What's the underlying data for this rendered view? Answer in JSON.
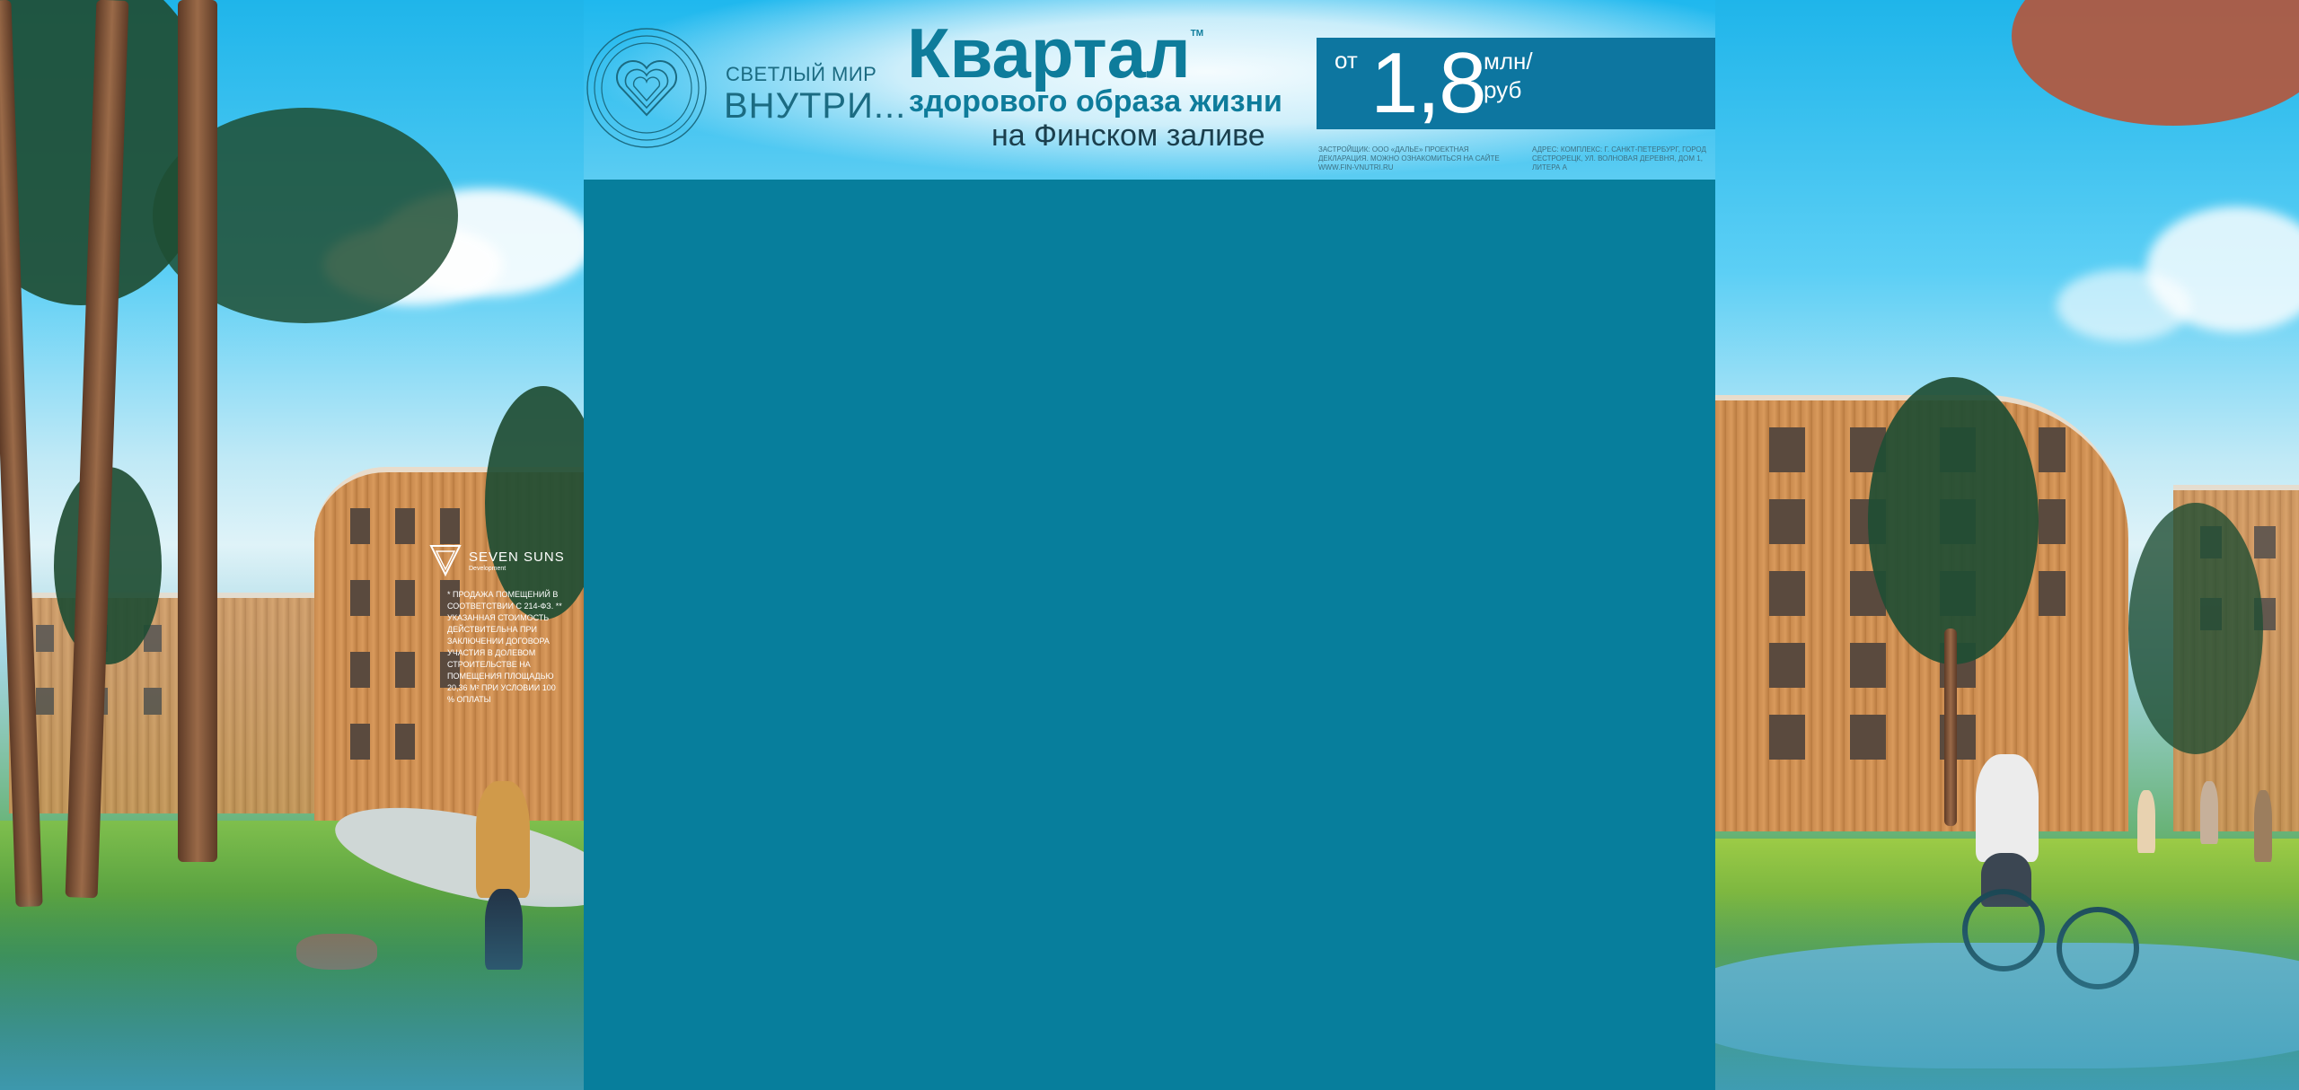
{
  "colors": {
    "panel": "#077e9c",
    "price_box": "#0d76a0",
    "title": "#0e7c9b",
    "brand": "#1b6b82"
  },
  "header": {
    "brand_small": "СВЕТЛЫЙ МИР",
    "brand_big": "ВНУТРИ...",
    "title": "Квартал",
    "subtitle_line1": "здорового образа жизни",
    "subtitle_line2": "на Финском заливе",
    "price_from": "от",
    "price_value": "1,8",
    "price_unit_line1": "млн/",
    "price_unit_line2": "руб",
    "legal_left": "ЗАСТРОЙЩИК: ООО «ДАЛЬЕ» ПРОЕКТНАЯ ДЕКЛАРАЦИЯ. МОЖНО ОЗНАКОМИТЬСЯ НА САЙТЕ WWW.FIN-VNUTRI.RU",
    "legal_right": "АДРЕС: КОМПЛЕКС: Г. САНКТ-ПЕТЕРБУРГ, ГОРОД СЕСТРОРЕЦК, УЛ. ВОЛНОВАЯ ДЕРЕВНЯ, ДОМ 1, ЛИТЕРА А"
  },
  "overlay": {
    "developer": "SEVEN SUNS",
    "developer_sub": "Development",
    "disclaimer": "* ПРОДАЖА ПОМЕЩЕНИЙ В СООТВЕТСТВИИ С 214-ФЗ. ** УКАЗАННАЯ СТОИМОСТЬ ДЕЙСТВИТЕЛЬНА ПРИ ЗАКЛЮЧЕНИИ ДОГОВОРА УЧАСТИЯ В ДОЛЕВОМ СТРОИТЕЛЬСТВЕ НА ПОМЕЩЕНИЯ ПЛОЩАДЬЮ 20,36 М² ПРИ УСЛОВИИ 100 % ОПЛАТЫ"
  },
  "icons": {
    "logo": "heart-logo-icon",
    "developer_mark": "seven-suns-logo-icon"
  }
}
